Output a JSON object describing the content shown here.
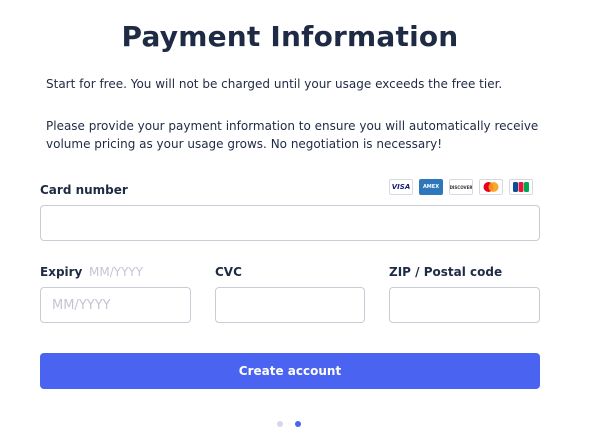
{
  "title": "Payment Information",
  "intro": "Start for free. You will not be charged until your usage exceeds the free tier.",
  "description": "Please provide your payment information to ensure you will automatically receive volume pricing as your usage grows. No negotiation is necessary!",
  "card_number": {
    "label": "Card number",
    "value": "",
    "placeholder": ""
  },
  "card_brands": [
    {
      "name": "visa-icon",
      "text": "VISA"
    },
    {
      "name": "amex-icon",
      "text": "AMEX"
    },
    {
      "name": "discover-icon",
      "text": "DISCOVER"
    },
    {
      "name": "mastercard-icon",
      "text": ""
    },
    {
      "name": "jcb-icon",
      "text": ""
    }
  ],
  "expiry": {
    "label": "Expiry",
    "hint": "MM/YYYY",
    "placeholder": "MM/YYYY"
  },
  "cvc": {
    "label": "CVC",
    "placeholder": ""
  },
  "zip": {
    "label": "ZIP / Postal code",
    "placeholder": ""
  },
  "submit_label": "Create account",
  "pagination": {
    "total": 2,
    "current": 2
  },
  "colors": {
    "accent": "#4a63f0",
    "text": "#1f2a44",
    "placeholder": "#c3c6d2",
    "border": "#c9ccd6"
  }
}
